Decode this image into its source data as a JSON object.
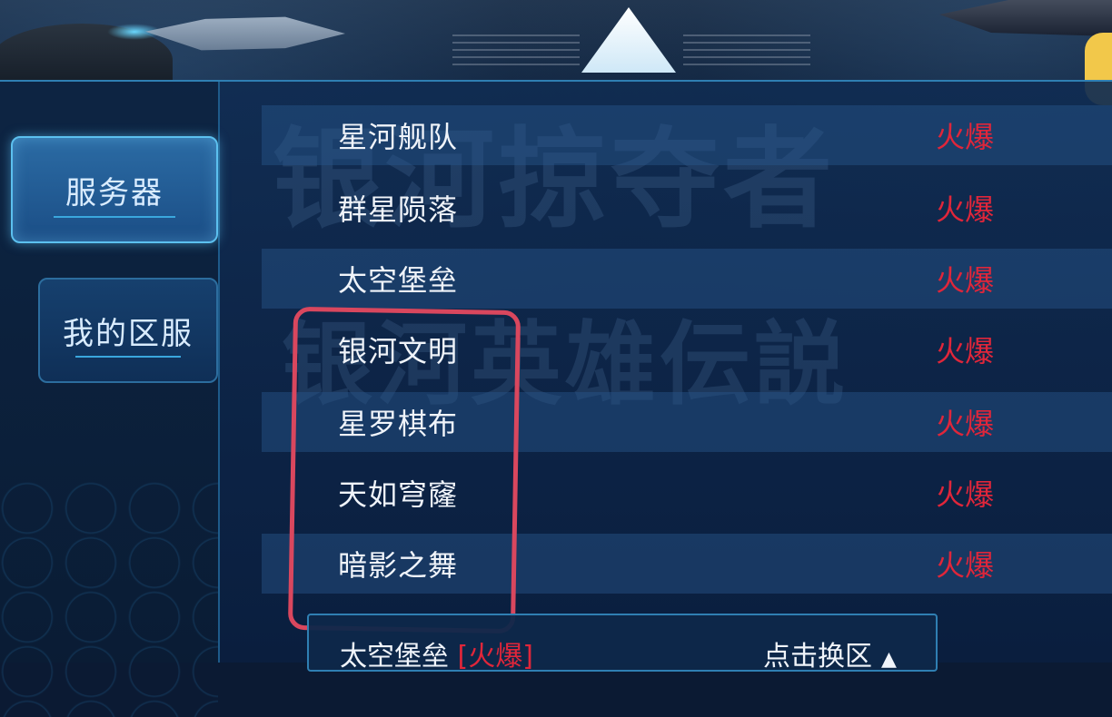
{
  "sidebar": {
    "tabs": [
      {
        "label": "服务器",
        "active": true
      },
      {
        "label": "我的区服",
        "active": false
      }
    ]
  },
  "watermark": {
    "line1": "银河掠夺者",
    "line2": "银河英雄伝説"
  },
  "servers": [
    {
      "name": "星河舰队",
      "status": "火爆"
    },
    {
      "name": "群星陨落",
      "status": "火爆"
    },
    {
      "name": "太空堡垒",
      "status": "火爆"
    },
    {
      "name": "银河文明",
      "status": "火爆"
    },
    {
      "name": "星罗棋布",
      "status": "火爆"
    },
    {
      "name": "天如穹窿",
      "status": "火爆"
    },
    {
      "name": "暗影之舞",
      "status": "火爆"
    }
  ],
  "current": {
    "name": "太空堡垒",
    "status": "[火爆]",
    "switch_label": "点击换区"
  },
  "colors": {
    "hot": "#e0263a",
    "accent": "#5cc0ef"
  }
}
